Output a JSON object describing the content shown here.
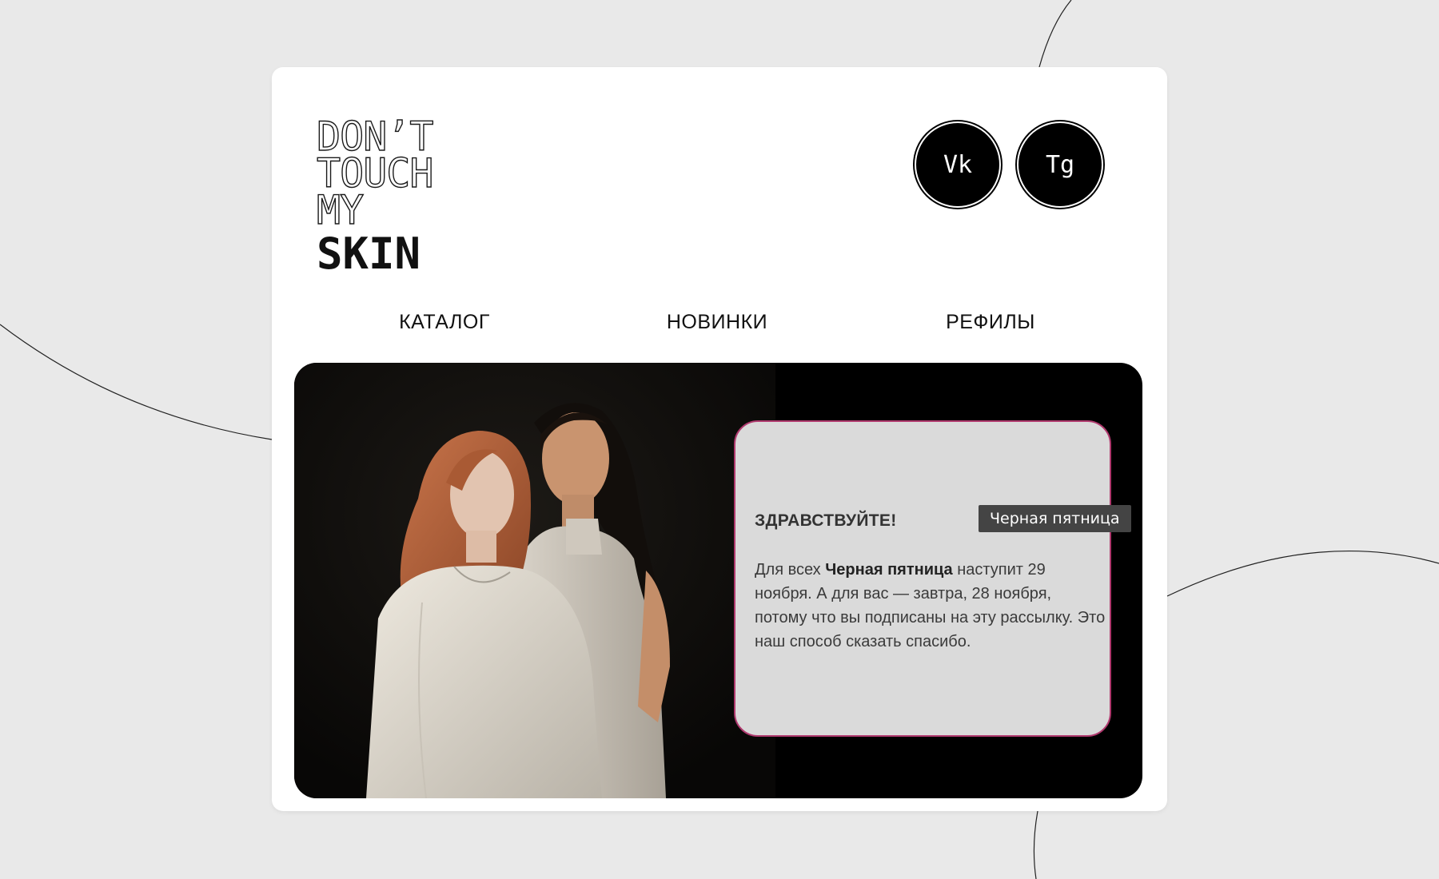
{
  "logo": {
    "line1": "DON’T",
    "line2": "TOUCH",
    "line3": "MY",
    "line4": "SKIN"
  },
  "social": {
    "vk_label": "Vk",
    "tg_label": "Tg"
  },
  "nav": {
    "items": [
      {
        "label": "КАТАЛОГ"
      },
      {
        "label": "НОВИНКИ"
      },
      {
        "label": "РЕФИЛЫ"
      }
    ]
  },
  "promo": {
    "greeting": "ЗДРАВСТВУЙТЕ!",
    "text_part1": "Для всех ",
    "text_bold": "Черная пятница",
    "text_part2": " наступит 29 ноября. А для вас — завтра, 28 ноября, потому что вы подписаны на эту рассылку. Это наш способ сказать спасибо."
  },
  "tooltip": {
    "text": "Черная пятница"
  },
  "colors": {
    "background": "#e9e9e9",
    "card": "#ffffff",
    "hero": "#000000",
    "promo_box": "#dadada",
    "promo_border": "#b0396e",
    "tooltip": "#444444"
  }
}
